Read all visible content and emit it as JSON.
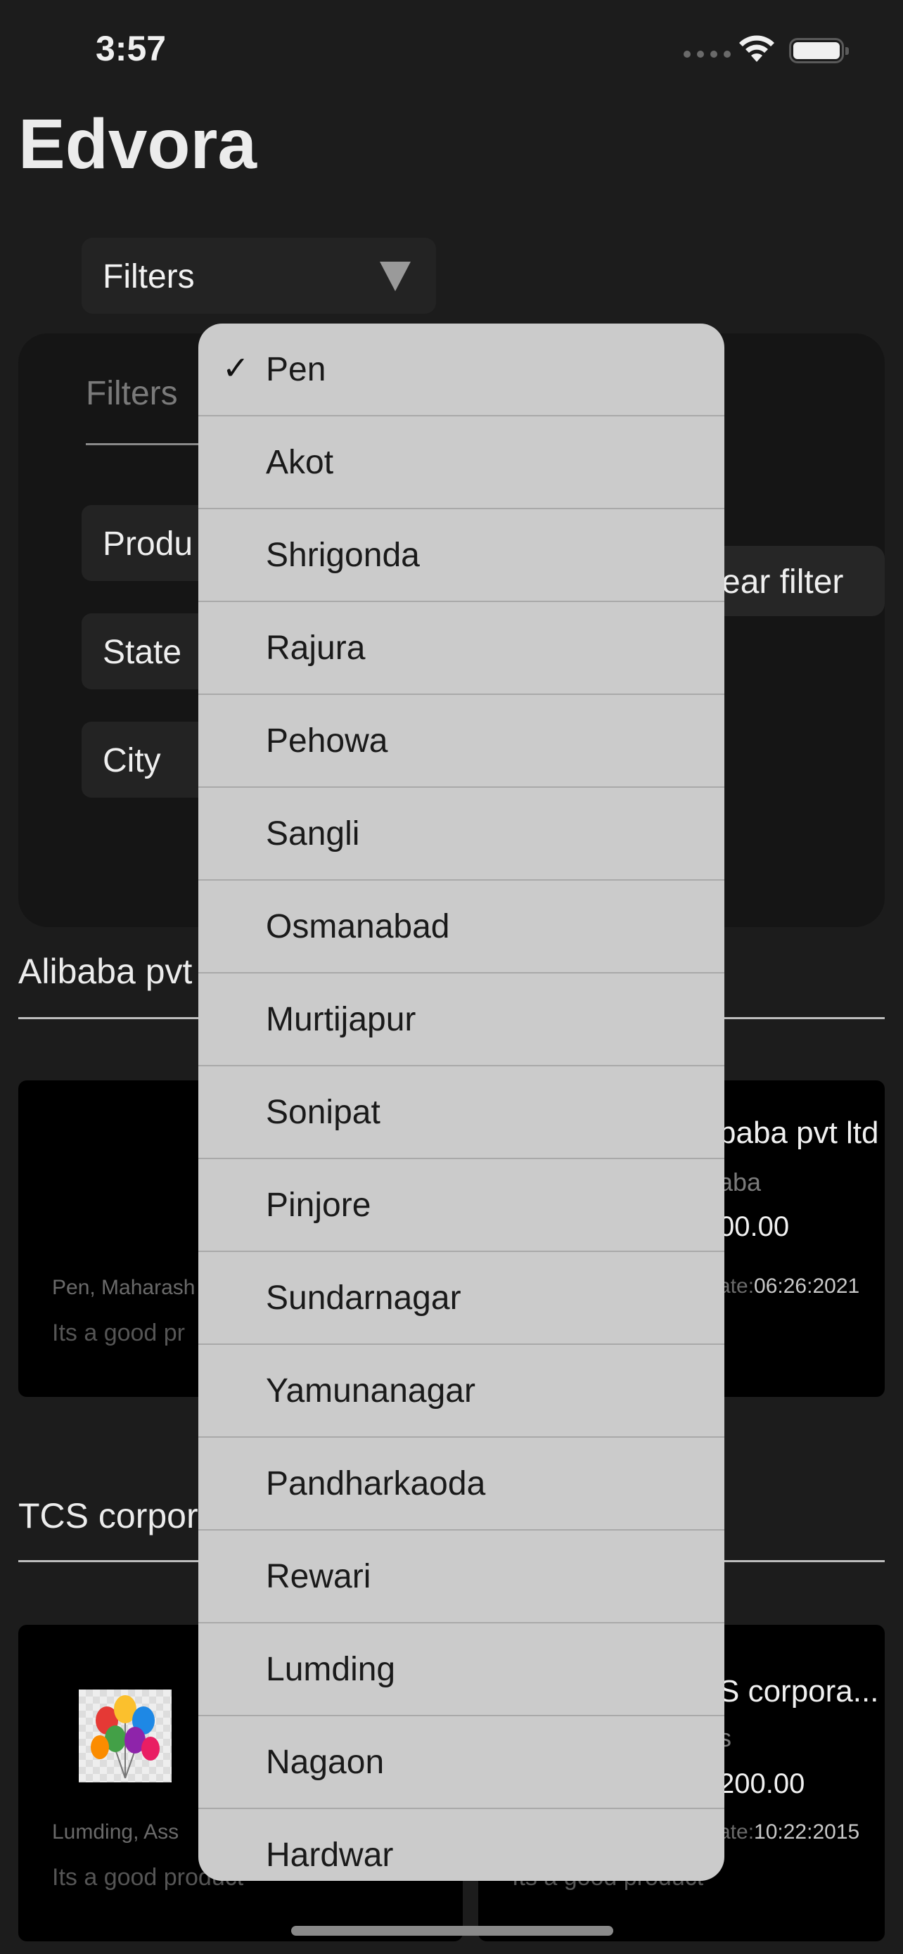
{
  "status_bar": {
    "time": "3:57"
  },
  "app": {
    "title": "Edvora"
  },
  "filters_select": {
    "label": "Filters"
  },
  "filter_panel": {
    "title": "Filters",
    "product_label": "Produ",
    "state_label": "State",
    "city_label": "City",
    "clear_label": "ear filter"
  },
  "sections": [
    {
      "title": "Alibaba pvt",
      "card_left": {
        "location": "Pen, Maharash",
        "description": "Its a good pr"
      },
      "card_right": {
        "name": "baba pvt ltd",
        "brand": "aba",
        "price": "00.00",
        "date_label": "ate:",
        "date_value": "06:26:2021"
      }
    },
    {
      "title": "TCS corpor",
      "card_left": {
        "image_icon": "balloons-image",
        "location": "Lumding, Ass",
        "description": "Its a good product"
      },
      "card_right": {
        "name": "S corpora...",
        "brand": "s",
        "price": "200.00",
        "date_label": "ate:",
        "date_value": "10:22:2015",
        "description": "Its a good product"
      }
    }
  ],
  "city_menu": {
    "selected": "Pen",
    "items": [
      "Pen",
      "Akot",
      "Shrigonda",
      "Rajura",
      "Pehowa",
      "Sangli",
      "Osmanabad",
      "Murtijapur",
      "Sonipat",
      "Pinjore",
      "Sundarnagar",
      "Yamunanagar",
      "Pandharkaoda",
      "Rewari",
      "Lumding",
      "Nagaon",
      "Hardwar"
    ]
  },
  "colors": {
    "background": "#1c1c1c",
    "menu": "#cbcbcb",
    "card": "#000000"
  }
}
